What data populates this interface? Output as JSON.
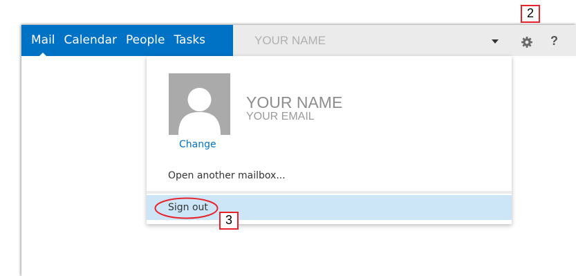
{
  "nav": {
    "tabs": [
      {
        "label": "Mail",
        "active": true
      },
      {
        "label": "Calendar",
        "active": false
      },
      {
        "label": "People",
        "active": false
      },
      {
        "label": "Tasks",
        "active": false
      }
    ]
  },
  "header": {
    "user_display": "YOUR NAME",
    "dropdown_icon": "caret-down-icon",
    "settings_icon": "gear-icon",
    "help_label": "?"
  },
  "callouts": {
    "step2": "2",
    "step3": "3"
  },
  "account_menu": {
    "avatar_icon": "person-silhouette-icon",
    "change_label": "Change",
    "name": "YOUR NAME",
    "email": "YOUR EMAIL",
    "open_mailbox_label": "Open another mailbox...",
    "sign_out_label": "Sign out"
  },
  "colors": {
    "brand_blue": "#0072c6",
    "highlight": "#cde6f7",
    "callout_red": "#e8222b"
  }
}
